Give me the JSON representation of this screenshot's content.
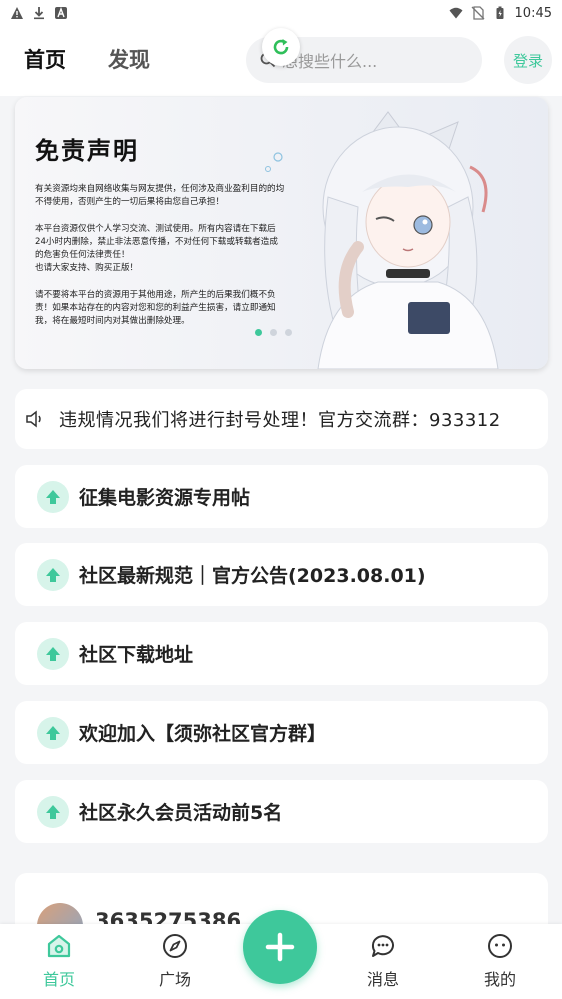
{
  "status_bar": {
    "time": "10:45"
  },
  "header": {
    "tabs": [
      {
        "label": "首页",
        "active": true
      },
      {
        "label": "发现",
        "active": false
      }
    ],
    "search": {
      "placeholder": "想搜些什么..."
    },
    "login_label": "登录",
    "accent": "#3ec89b"
  },
  "banner": {
    "title": "免责声明",
    "text": "有关资源均来自网络收集与网友提供，任何涉及商业盈利目的的均不得使用，否则产生的一切后果将由您自己承担！\n\n本平台资源仅供个人学习交流、测试使用。所有内容请在下载后24小时内删除，禁止非法恶意传播，不对任何下载或转载者造成的危害负任何法律责任！\n也请大家支持、购买正版！\n\n请不要将本平台的资源用于其他用途，所产生的后果我们概不负责！如果本站存在的内容对您和您的利益产生损害，请立即通知我，将在最短时间内对其做出删除处理。"
  },
  "notice": {
    "text": "违规情况我们将进行封号处理！官方交流群：933312"
  },
  "posts": [
    {
      "title": "征集电影资源专用帖"
    },
    {
      "title": "社区最新规范｜官方公告(2023.08.01)"
    },
    {
      "title": "社区下载地址"
    },
    {
      "title": "欢迎加入【须弥社区官方群】"
    },
    {
      "title": "社区永久会员活动前5名"
    }
  ],
  "user_card": {
    "username": "3635275386"
  },
  "bottom_nav": [
    {
      "label": "首页",
      "icon": "home-icon",
      "active": true
    },
    {
      "label": "广场",
      "icon": "compass-icon",
      "active": false
    },
    {
      "label": "消息",
      "icon": "message-icon",
      "active": false
    },
    {
      "label": "我的",
      "icon": "profile-icon",
      "active": false
    }
  ]
}
